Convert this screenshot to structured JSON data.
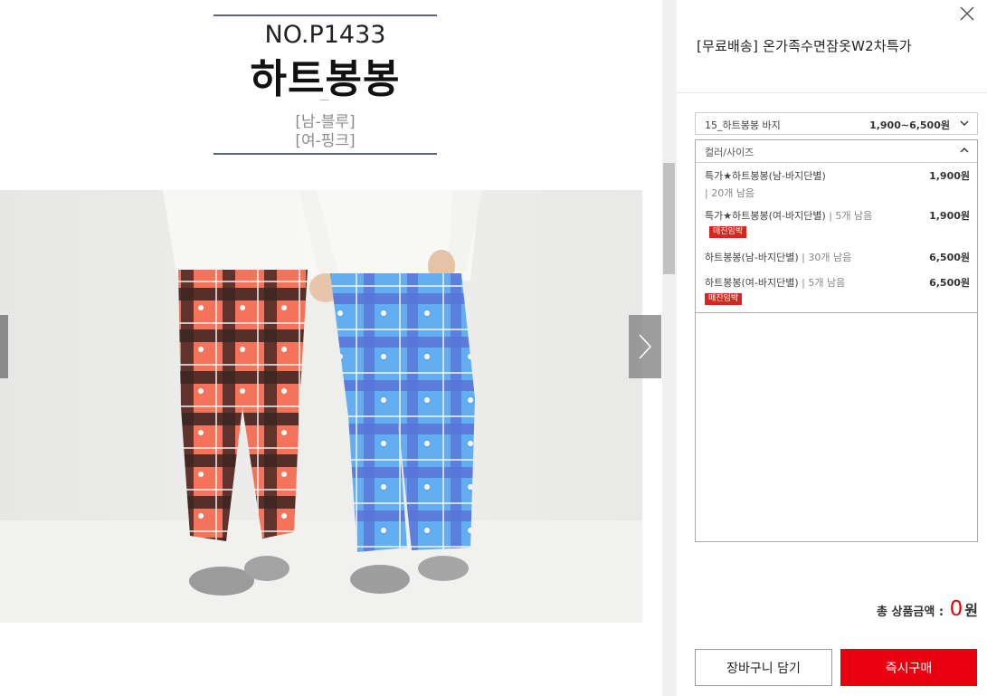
{
  "product_header": {
    "number": "NO.P1433",
    "name": "하트봉봉",
    "variant_male": "[남-블루]",
    "variant_female": "[여-핑크]"
  },
  "photo": {
    "description_icon": "product-photo",
    "left_pants_color": "#f4735a",
    "right_pants_color": "#5fa6e8"
  },
  "nav": {
    "prev_icon": "chevron-left-icon",
    "next_icon": "chevron-right-icon"
  },
  "panel": {
    "close_icon": "close-icon",
    "title": "[무료배송] 온가족수면잠옷W2차특가",
    "option_select": {
      "label": "15_하트봉봉 바지",
      "price_range": "1,900~6,500원"
    },
    "option_dropdown": {
      "header": "컬러/사이즈",
      "items": [
        {
          "name": "특가★하트봉봉(남-바지단별)",
          "stock": "| 20개 남음",
          "price": "1,900원",
          "badge": ""
        },
        {
          "name": "특가★하트봉봉(여-바지단별)",
          "stock": "| 5개 남음",
          "price": "1,900원",
          "badge": "매진임박"
        },
        {
          "name": "하트봉봉(남-바지단별)",
          "stock": "| 30개 남음",
          "price": "6,500원",
          "badge": ""
        },
        {
          "name": "하트봉봉(여-바지단별)",
          "stock": "| 5개 남음",
          "price": "6,500원",
          "badge": "매진임박"
        }
      ]
    },
    "total": {
      "label": "총 상품금액 :",
      "value": "0",
      "unit": "원"
    },
    "buttons": {
      "cart": "장바구니 담기",
      "buy": "즉시구매"
    }
  },
  "colors": {
    "accent_red": "#e8000f",
    "badge_red": "#d9261c",
    "header_line": "#5b6478"
  }
}
